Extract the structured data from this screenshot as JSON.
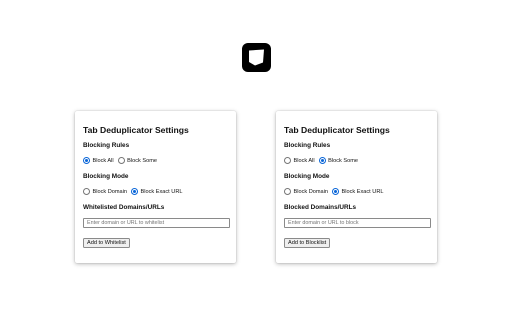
{
  "logo": {
    "icon": "tab-deduplicator-logo-icon"
  },
  "panels": [
    {
      "title": "Tab Deduplicator Settings",
      "blocking_rules": {
        "label": "Blocking Rules",
        "options": [
          "Block All",
          "Block Some"
        ],
        "selected": "Block All"
      },
      "blocking_mode": {
        "label": "Blocking Mode",
        "options": [
          "Block Domain",
          "Block Exact URL"
        ],
        "selected": "Block Exact URL"
      },
      "list_label": "Whitelisted Domains/URLs",
      "input_placeholder": "Enter domain or URL to whitelist",
      "button_label": "Add to Whitelist"
    },
    {
      "title": "Tab Deduplicator Settings",
      "blocking_rules": {
        "label": "Blocking Rules",
        "options": [
          "Block All",
          "Block Some"
        ],
        "selected": "Block Some"
      },
      "blocking_mode": {
        "label": "Blocking Mode",
        "options": [
          "Block Domain",
          "Block Exact URL"
        ],
        "selected": "Block Exact URL"
      },
      "list_label": "Blocked Domains/URLs",
      "input_placeholder": "Enter domain or URL to block",
      "button_label": "Add to Blocklist"
    }
  ],
  "colors": {
    "radio_accent": "#0a66d8",
    "logo": "#000000"
  }
}
